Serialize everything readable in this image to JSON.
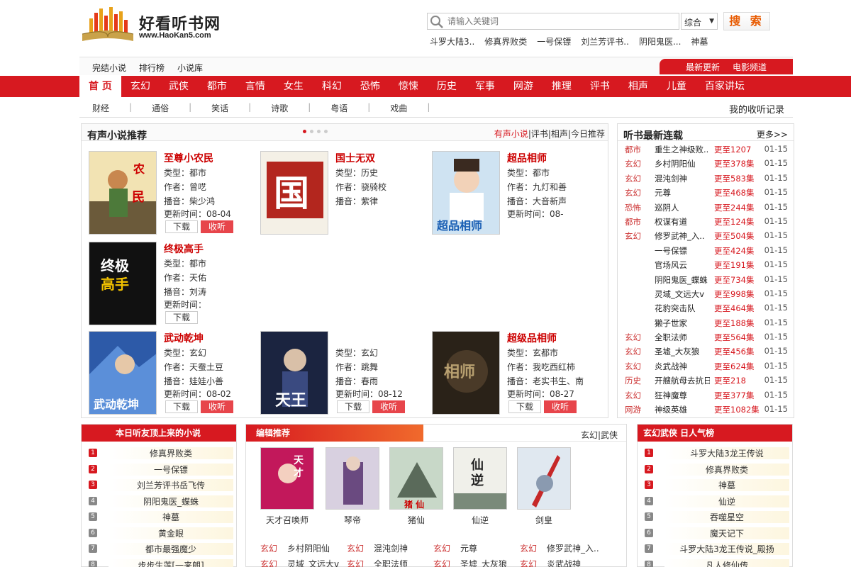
{
  "site": {
    "name": "好看听书网",
    "url": "www.HaoKan5.com"
  },
  "search": {
    "placeholder": "请输入关键词",
    "select": "综合",
    "button": "搜 索",
    "hot_words": [
      "斗罗大陆3..",
      "修真界败类",
      "一号保镖",
      "刘兰芳评书..",
      "阴阳鬼医...",
      "神墓"
    ]
  },
  "topbar": {
    "links": [
      "完结小说",
      "排行榜",
      "小说库"
    ],
    "right": [
      "最新更新",
      "电影频道"
    ]
  },
  "mainnav": [
    "首 页",
    "玄幻",
    "武侠",
    "都市",
    "言情",
    "女生",
    "科幻",
    "恐怖",
    "惊悚",
    "历史",
    "军事",
    "网游",
    "推理",
    "评书",
    "相声",
    "儿童",
    "百家讲坛"
  ],
  "subnav": {
    "items": [
      "财经",
      "通俗",
      "笑话",
      "诗歌",
      "粤语",
      "戏曲"
    ],
    "right": "我的收听记录"
  },
  "recommend": {
    "title": "有声小说推荐",
    "tabs": [
      "有声小说",
      "评书",
      "相声",
      "今日推荐"
    ],
    "books": [
      {
        "title": "至尊小农民",
        "type": "类型：都市",
        "author": "作者：曾呓",
        "anchor": "播音：柴少鸿",
        "update": "更新时间：08-04"
      },
      {
        "title": "国士无双",
        "type": "类型：历史",
        "author": "作者：骁骑校",
        "anchor": "播音：紫律",
        "update": ""
      },
      {
        "title": "超品相师",
        "type": "类型：都市",
        "author": "作者：九灯和善",
        "anchor": "播音：大音新声",
        "update": "更新时间：08-"
      },
      {
        "title": "终极高手",
        "type": "类型：都市",
        "author": "作者：天佑",
        "anchor": "播音：刘涛",
        "update": "更新时间："
      },
      {
        "title": "武动乾坤",
        "type": "类型：玄幻",
        "author": "作者：天蚕土豆",
        "anchor": "播音：娃娃小善",
        "update": "更新时间：08-02"
      },
      {
        "title": "",
        "type": "类型：玄幻",
        "author": "作者：跳舞",
        "anchor": "播音：春雨",
        "update": "更新时间：08-12"
      },
      {
        "title": "超级品相师",
        "type": "类型：玄都市",
        "author": "作者：我吃西红柿",
        "anchor": "播音：老实书生、南",
        "update": "更新时间：08-27"
      }
    ],
    "btn_download": "下载",
    "btn_listen": "收听"
  },
  "latest": {
    "title": "听书最新连载",
    "more": "更多>>",
    "rows": [
      {
        "cat": "都市",
        "title": "重生之神级败..",
        "upd": "更至1207",
        "date": "01-15"
      },
      {
        "cat": "玄幻",
        "title": "乡村阴阳仙",
        "upd": "更至378集",
        "date": "01-15"
      },
      {
        "cat": "玄幻",
        "title": "混沌剑神",
        "upd": "更至583集",
        "date": "01-15"
      },
      {
        "cat": "玄幻",
        "title": "元尊",
        "upd": "更至468集",
        "date": "01-15"
      },
      {
        "cat": "恐怖",
        "title": "巡阴人",
        "upd": "更至244集",
        "date": "01-15"
      },
      {
        "cat": "都市",
        "title": "权谋有道",
        "upd": "更至124集",
        "date": "01-15"
      },
      {
        "cat": "玄幻",
        "title": "修罗武神_入..",
        "upd": "更至504集",
        "date": "01-15"
      },
      {
        "cat": "",
        "title": "一号保镖",
        "upd": "更至424集",
        "date": "01-15"
      },
      {
        "cat": "",
        "title": "官场风云",
        "upd": "更至191集",
        "date": "01-15"
      },
      {
        "cat": "",
        "title": "阴阳鬼医_蝶蛛",
        "upd": "更至734集",
        "date": "01-15"
      },
      {
        "cat": "",
        "title": "灵域_文远大v",
        "upd": "更至998集",
        "date": "01-15"
      },
      {
        "cat": "",
        "title": "花豹突击队",
        "upd": "更至464集",
        "date": "01-15"
      },
      {
        "cat": "",
        "title": "獭子世家",
        "upd": "更至188集",
        "date": "01-15"
      },
      {
        "cat": "玄幻",
        "title": "全职法师",
        "upd": "更至564集",
        "date": "01-15"
      },
      {
        "cat": "玄幻",
        "title": "圣墟_大灰狼",
        "upd": "更至456集",
        "date": "01-15"
      },
      {
        "cat": "玄幻",
        "title": "炎武战神",
        "upd": "更至624集",
        "date": "01-15"
      },
      {
        "cat": "历史",
        "title": "开艘航母去抗日",
        "upd": "更至218",
        "date": "01-15"
      },
      {
        "cat": "玄幻",
        "title": "狂神魔尊",
        "upd": "更至377集",
        "date": "01-15"
      },
      {
        "cat": "网游",
        "title": "神级英雄",
        "upd": "更至1082集",
        "date": "01-15"
      }
    ]
  },
  "today_rank": {
    "title": "本日听友顶上来的小说",
    "items": [
      "修真界败类",
      "一号保镖",
      "刘兰芳评书岳飞传",
      "阴阳鬼医_蝶蛛",
      "神墓",
      "黄金眼",
      "都市最强魔少",
      "步步生莲[一来朗]"
    ]
  },
  "editor": {
    "title": "编辑推荐",
    "right": "玄幻|武侠",
    "covers": [
      "天才召唤师",
      "琴帝",
      "猪仙",
      "仙逆",
      "剑皇"
    ],
    "rows": [
      [
        {
          "cat": "玄幻",
          "name": "乡村阴阳仙"
        },
        {
          "cat": "玄幻",
          "name": "混沌剑神"
        },
        {
          "cat": "玄幻",
          "name": "元尊"
        },
        {
          "cat": "玄幻",
          "name": "修罗武神_入.."
        }
      ],
      [
        {
          "cat": "玄幻",
          "name": "灵域_文远大v"
        },
        {
          "cat": "玄幻",
          "name": "全职法师"
        },
        {
          "cat": "玄幻",
          "name": "圣墟_大灰狼"
        },
        {
          "cat": "玄幻",
          "name": "炎武战神"
        }
      ]
    ]
  },
  "fantasy_rank": {
    "title": "玄幻武侠 日人气榜",
    "items": [
      "斗罗大陆3龙王传说",
      "修真界败类",
      "神墓",
      "仙逆",
      "吞噬星空",
      "魔天记下",
      "斗罗大陆3龙王传说_殿扬",
      "凡人修仙传"
    ]
  },
  "colors": {
    "brand_red": "#d71920",
    "title_red": "#cc0000",
    "listen_btn": "#e7454b"
  }
}
